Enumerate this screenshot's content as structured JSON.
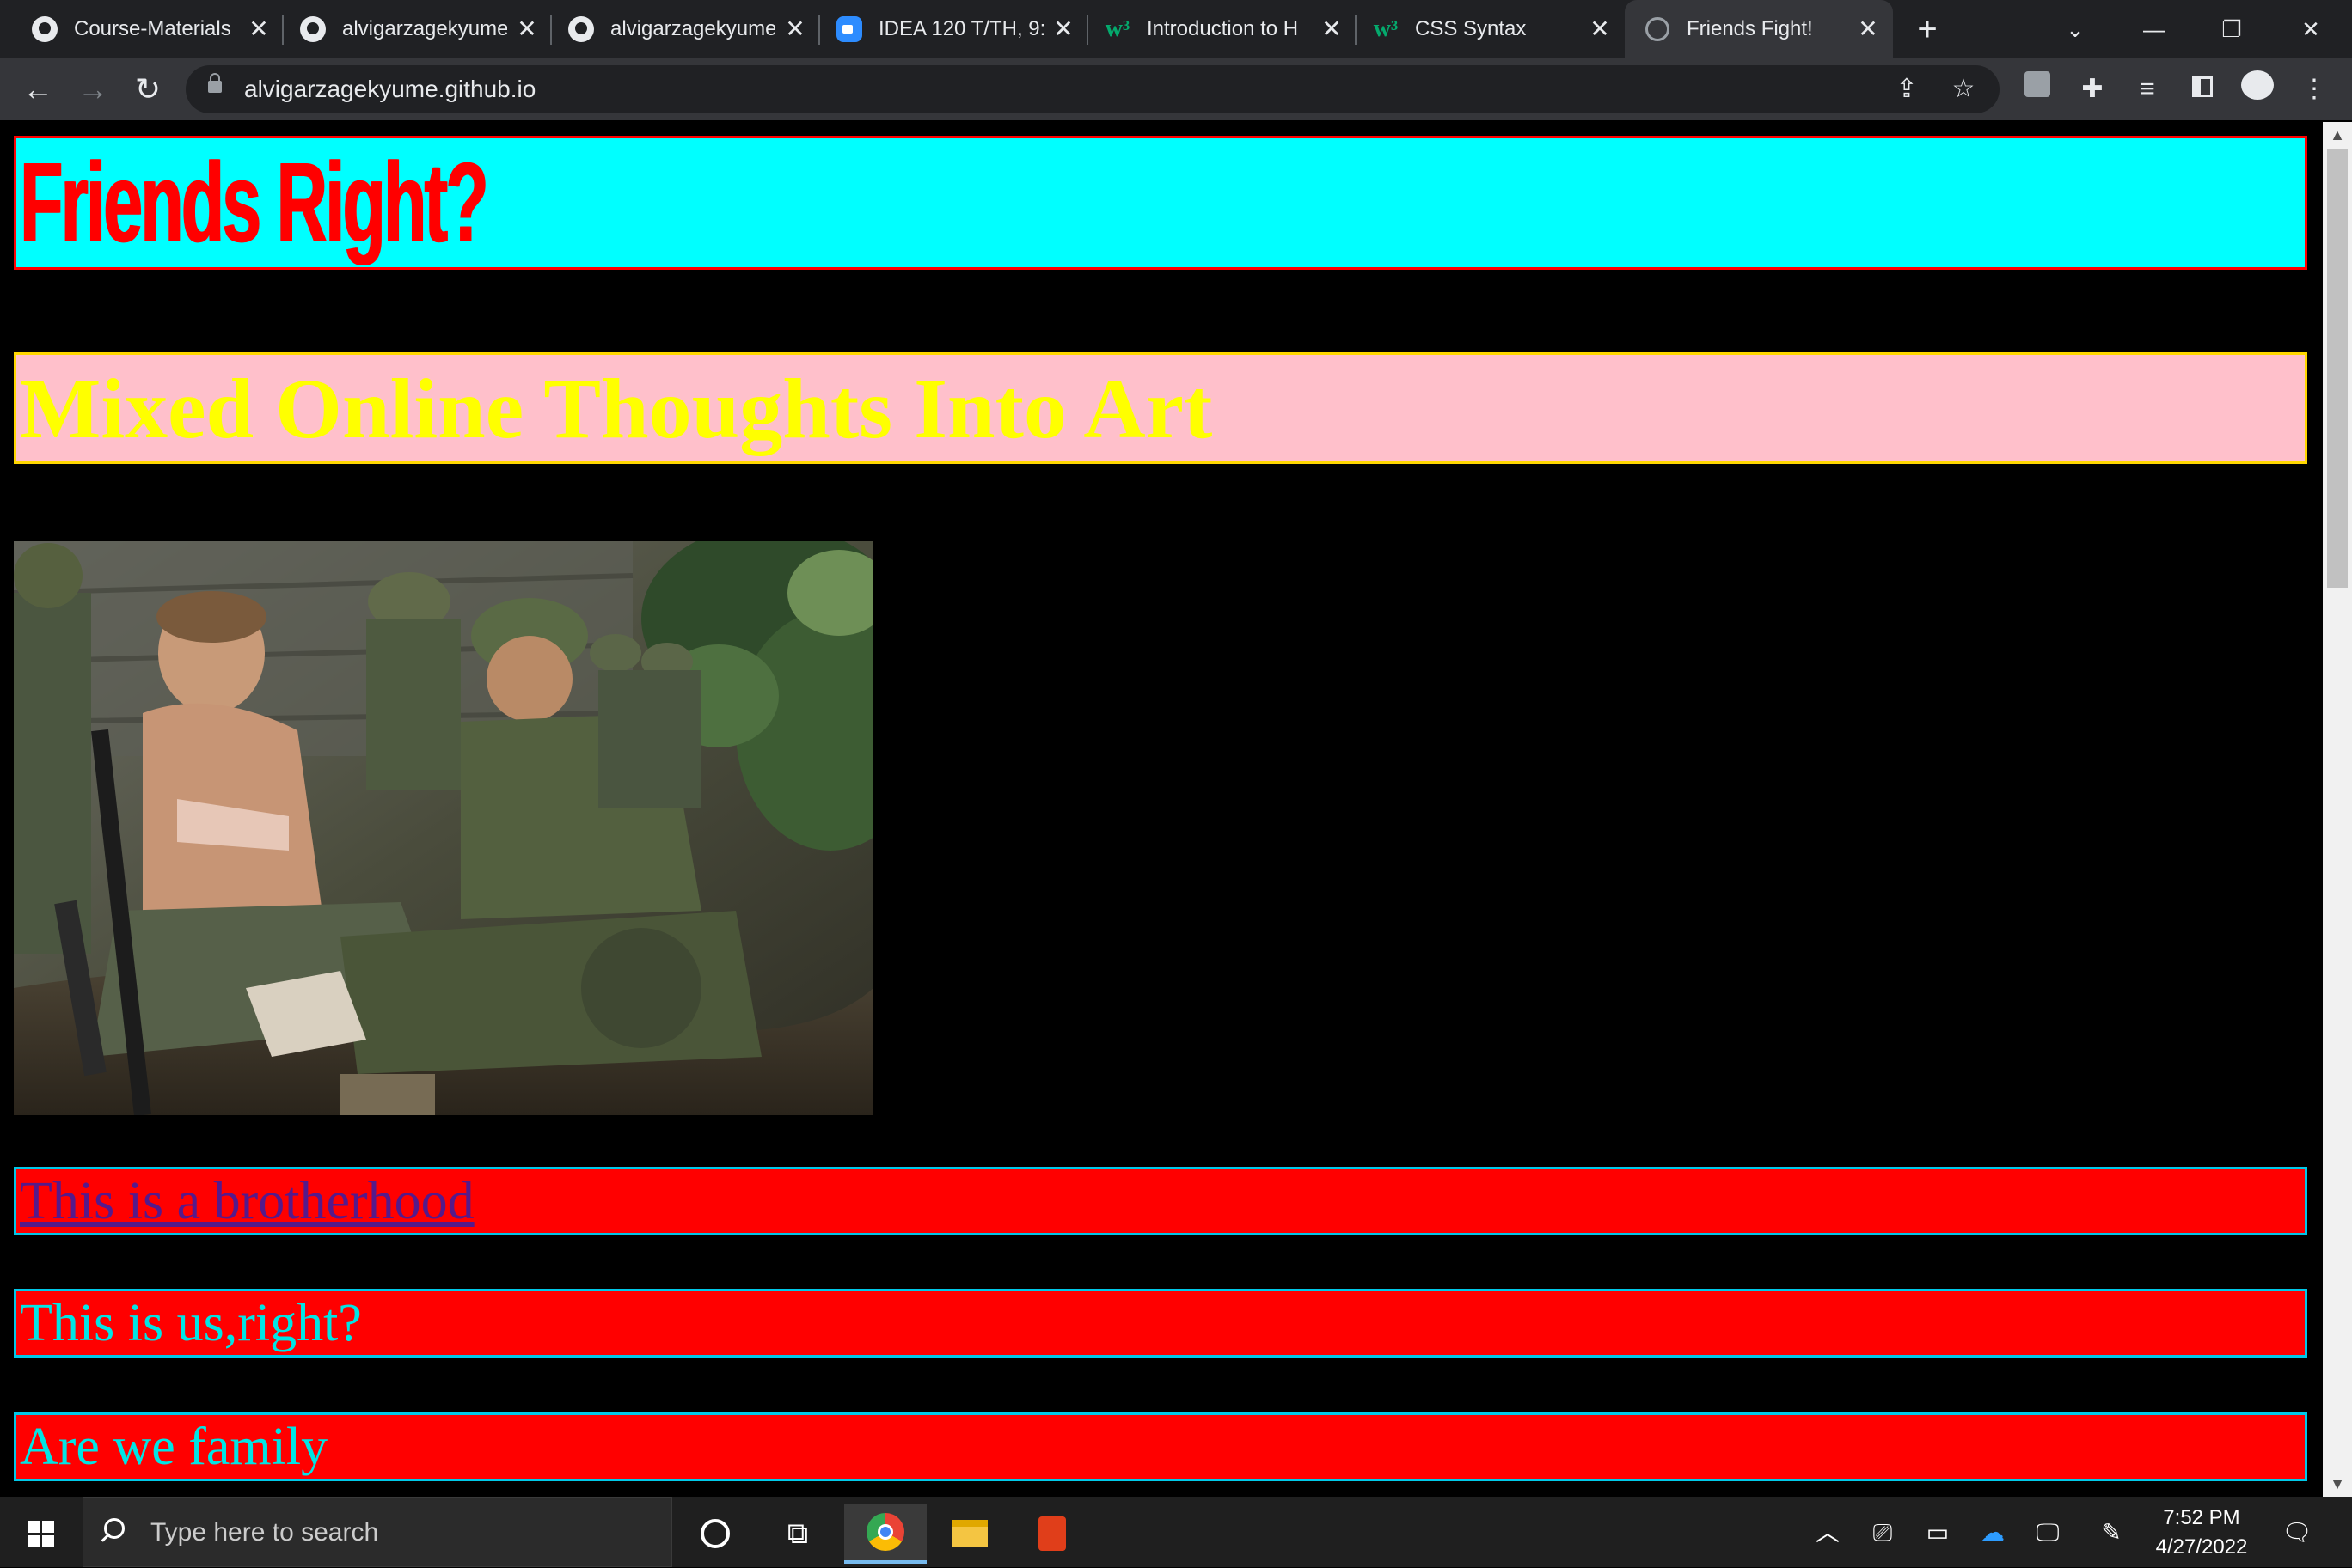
{
  "browser": {
    "tabs": [
      {
        "title": "Course-Materials",
        "favicon": "github-icon",
        "active": false
      },
      {
        "title": "alvigarzagekyume",
        "favicon": "github-icon",
        "active": false
      },
      {
        "title": "alvigarzagekyume",
        "favicon": "github-icon",
        "active": false
      },
      {
        "title": "IDEA 120 T/TH, 9:",
        "favicon": "zoom-icon",
        "active": false
      },
      {
        "title": "Introduction to H",
        "favicon": "w3schools-icon",
        "active": false
      },
      {
        "title": "CSS Syntax",
        "favicon": "w3schools-icon",
        "active": false
      },
      {
        "title": "Friends Fight!",
        "favicon": "globe-icon",
        "active": true
      }
    ],
    "url": "alvigarzagekyume.github.io"
  },
  "page": {
    "heading": "Friends Right?",
    "subheading": "Mixed Online Thoughts Into Art",
    "image_alt": "Photo of soldiers resting in the jungle",
    "paragraphs": [
      {
        "text": "This is a brotherhood",
        "is_link": true
      },
      {
        "text": "This is us,right?",
        "is_link": false
      },
      {
        "text": "Are we family",
        "is_link": false
      }
    ],
    "colors": {
      "page_background": "#000000",
      "heading_bg": "#00ffff",
      "heading_text": "#ff0000",
      "subheading_bg": "#ffc0cb",
      "subheading_text": "#ffff00",
      "paragraph_bg": "#ff0000",
      "paragraph_text": "#00e5e5",
      "link_text": "#551a8b"
    }
  },
  "taskbar": {
    "search_placeholder": "Type here to search",
    "time": "7:52 PM",
    "date": "4/27/2022"
  }
}
